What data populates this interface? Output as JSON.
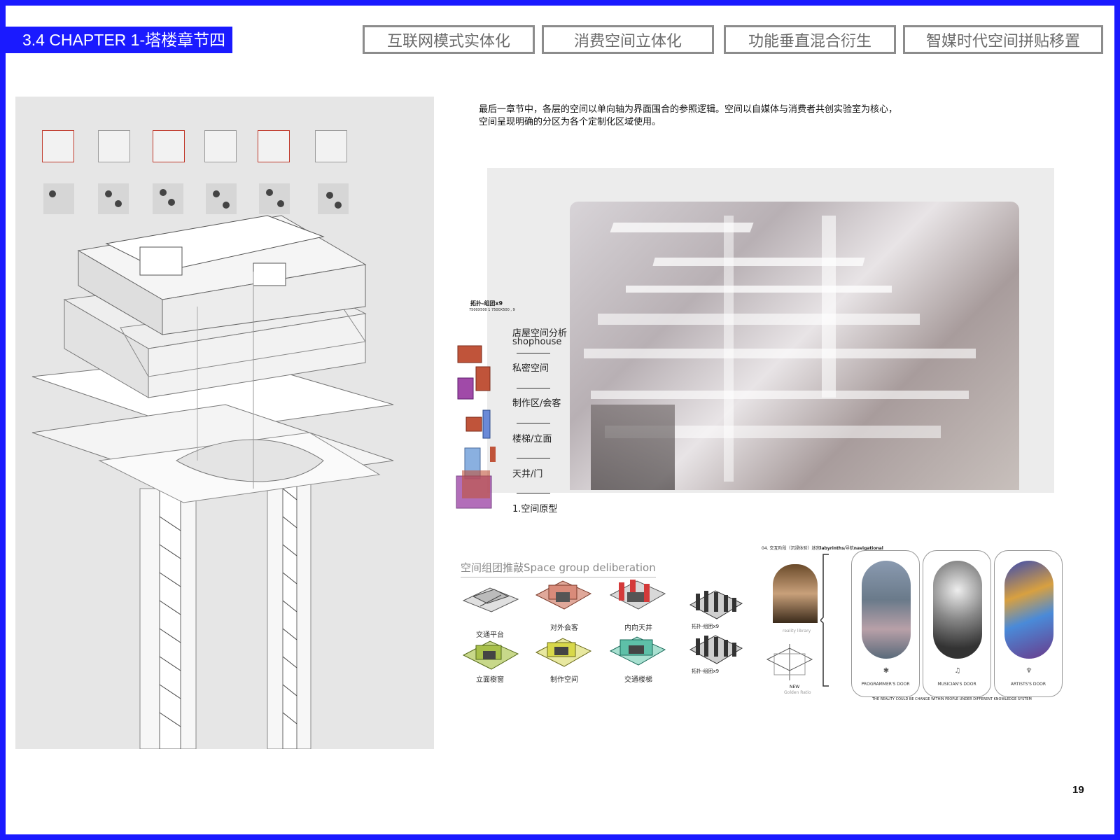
{
  "chapter": {
    "label": "3.4 CHAPTER 1-塔楼章节四"
  },
  "tabs": [
    {
      "label": "互联网模式实体化"
    },
    {
      "label": "消费空间立体化"
    },
    {
      "label": "功能垂直混合衍生"
    },
    {
      "label": "智媒时代空间拼贴移置"
    }
  ],
  "intro": {
    "line1": "最后一章节中，各层的空间以单向轴为界面围合的参照逻辑。空间以自媒体与消费者共创实验室为核心，",
    "line2": "空间呈现明确的分区为各个定制化区域使用。"
  },
  "legend": {
    "caption_small_a": "拓扑-组团x9",
    "caption_small_b": "7500X500 1 7500X500 , 9",
    "items": [
      {
        "label": "店屋空间分析"
      },
      {
        "label": "shophouse"
      },
      {
        "label": "私密空间"
      },
      {
        "label": "制作区/会客"
      },
      {
        "label": "楼梯/立面"
      },
      {
        "label": "天井/门"
      },
      {
        "label": "1.空间原型"
      }
    ]
  },
  "group": {
    "title": "空间组团推敲Space group deliberation",
    "items": [
      {
        "label": "交通平台",
        "color": "#9a9a9a"
      },
      {
        "label": "对外会客",
        "color": "#d98b7a"
      },
      {
        "label": "内向天井",
        "color": "#d43a3a"
      },
      {
        "label": "立面樹窗",
        "color": "#a8c04a"
      },
      {
        "label": "制作空间",
        "color": "#d8d84a"
      },
      {
        "label": "交通楼梯",
        "color": "#5ec0a8"
      }
    ],
    "cluster_caption_a": "拓扑-组团x9",
    "cluster_caption_b": "拓扑-组团x9"
  },
  "doors": {
    "header_prefix": "04. 交互阶段（沉浸体验）迷宫",
    "header_bold_a": "labyrinths",
    "header_mid": "/导航",
    "header_bold_b": "navigational",
    "library_label": "reality library",
    "new_label": "NEW",
    "golden_label": "Golden Ratio",
    "items": [
      {
        "label": "PROGRAMMER'S DOOR",
        "icon": "tree-icon",
        "glyph": "✱"
      },
      {
        "label": "MUSICIAN'S DOOR",
        "icon": "music-icon",
        "glyph": "♫"
      },
      {
        "label": "ARTISTS'S DOOR",
        "icon": "brush-icon",
        "glyph": "♆"
      }
    ],
    "footer": "THE REALITY COULD BE CHANGE WITHIN PEOPLE UNDER DIFFERENT KNOWLEDGE SYSTEM"
  },
  "page_number": "19"
}
